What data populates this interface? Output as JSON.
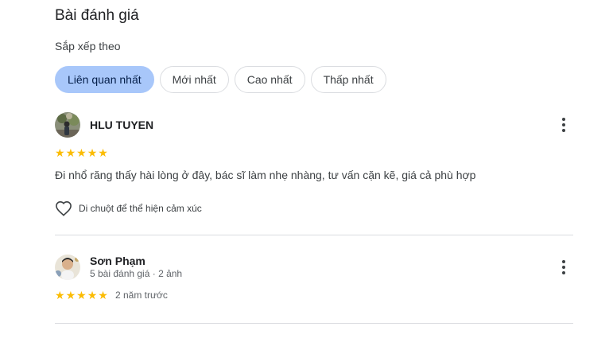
{
  "header": {
    "title": "Bài đánh giá",
    "sort_label": "Sắp xếp theo"
  },
  "sort_chips": [
    {
      "label": "Liên quan nhất",
      "selected": true
    },
    {
      "label": "Mới nhất",
      "selected": false
    },
    {
      "label": "Cao nhất",
      "selected": false
    },
    {
      "label": "Thấp nhất",
      "selected": false
    }
  ],
  "reviews": [
    {
      "author": "HLU TUYEN",
      "meta": "",
      "rating": 5,
      "rating_max": 5,
      "time": "",
      "text": "Đi nhổ răng thấy hài lòng ở đây, bác sĩ làm nhẹ nhàng, tư vấn cặn kẽ, giá cả phù hợp",
      "react_label": "Di chuột để thể hiện cảm xúc"
    },
    {
      "author": "Sơn Phạm",
      "meta": "5 bài đánh giá · 2 ảnh",
      "rating": 5,
      "rating_max": 5,
      "time": "2 năm trước"
    }
  ],
  "colors": {
    "star": "#fbbc04",
    "chip_selected": "#a8c7fa",
    "divider": "#dadce0"
  },
  "icons": [
    "heart-outline-icon",
    "more-vert-icon",
    "star-icon"
  ]
}
